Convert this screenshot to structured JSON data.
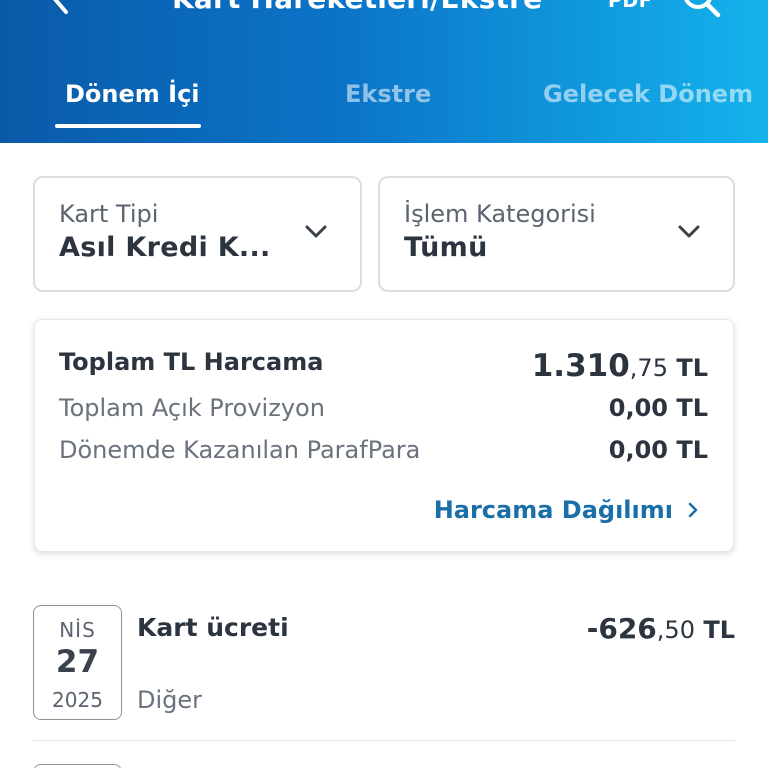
{
  "header": {
    "title": "Kart Hareketleri/Ekstre",
    "pdf_label": "PDF",
    "back_icon": "chevron-left-icon",
    "search_icon": "search-icon"
  },
  "tabs": [
    {
      "label": "Dönem İçi",
      "active": true
    },
    {
      "label": "Ekstre",
      "active": false
    },
    {
      "label": "Gelecek Dönem",
      "active": false
    }
  ],
  "filters": {
    "card_type": {
      "label": "Kart Tipi",
      "value": "Asıl Kredi K..."
    },
    "category": {
      "label": "İşlem Kategorisi",
      "value": "Tümü"
    }
  },
  "summary": {
    "total": {
      "label": "Toplam TL Harcama",
      "amount_int": "1.310",
      "amount_dec": ",75",
      "currency": " TL"
    },
    "provision": {
      "label": "Toplam Açık Provizyon",
      "amount": "0,00 TL"
    },
    "parafpara": {
      "label": "Dönemde Kazanılan ParafPara",
      "amount": "0,00 TL"
    },
    "breakdown_link": "Harcama Dağılımı"
  },
  "transactions": [
    {
      "month": "NİS",
      "day": "27",
      "year": "2025",
      "title": "Kart ücreti",
      "category": "Diğer",
      "amount_int": "-626",
      "amount_dec": ",50",
      "currency": " TL"
    }
  ],
  "colors": {
    "header_gradient_start": "#0a5aa8",
    "header_gradient_end": "#14b3ec",
    "link": "#1a6fa8",
    "text_primary": "#2c3440",
    "text_secondary": "#6a727d"
  }
}
